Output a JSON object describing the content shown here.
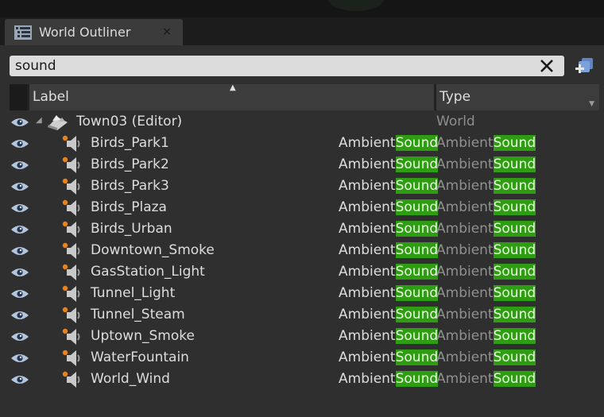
{
  "tab": {
    "title": "World Outliner",
    "close_glyph": "×"
  },
  "search": {
    "value": "sound"
  },
  "columns": {
    "label": "Label",
    "type": "Type"
  },
  "colors": {
    "highlight": "#2f9d12",
    "panel": "#2f2f2f",
    "search_bg": "#dcdcdc"
  },
  "root": {
    "label": "Town03 (Editor)",
    "type": "World",
    "icon": "world-icon"
  },
  "items": [
    {
      "label": "Birds_Park1",
      "class_prefix": "Ambient",
      "class_match": "Sound",
      "type_prefix": "Ambient",
      "type_match": "Sound"
    },
    {
      "label": "Birds_Park2",
      "class_prefix": "Ambient",
      "class_match": "Sound",
      "type_prefix": "Ambient",
      "type_match": "Sound"
    },
    {
      "label": "Birds_Park3",
      "class_prefix": "Ambient",
      "class_match": "Sound",
      "type_prefix": "Ambient",
      "type_match": "Sound"
    },
    {
      "label": "Birds_Plaza",
      "class_prefix": "Ambient",
      "class_match": "Sound",
      "type_prefix": "Ambient",
      "type_match": "Sound"
    },
    {
      "label": "Birds_Urban",
      "class_prefix": "Ambient",
      "class_match": "Sound",
      "type_prefix": "Ambient",
      "type_match": "Sound"
    },
    {
      "label": "Downtown_Smoke",
      "class_prefix": "Ambient",
      "class_match": "Sound",
      "type_prefix": "Ambient",
      "type_match": "Sound"
    },
    {
      "label": "GasStation_Light",
      "class_prefix": "Ambient",
      "class_match": "Sound",
      "type_prefix": "Ambient",
      "type_match": "Sound"
    },
    {
      "label": "Tunnel_Light",
      "class_prefix": "Ambient",
      "class_match": "Sound",
      "type_prefix": "Ambient",
      "type_match": "Sound"
    },
    {
      "label": "Tunnel_Steam",
      "class_prefix": "Ambient",
      "class_match": "Sound",
      "type_prefix": "Ambient",
      "type_match": "Sound"
    },
    {
      "label": "Uptown_Smoke",
      "class_prefix": "Ambient",
      "class_match": "Sound",
      "type_prefix": "Ambient",
      "type_match": "Sound"
    },
    {
      "label": "WaterFountain",
      "class_prefix": "Ambient",
      "class_match": "Sound",
      "type_prefix": "Ambient",
      "type_match": "Sound"
    },
    {
      "label": "World_Wind",
      "class_prefix": "Ambient",
      "class_match": "Sound",
      "type_prefix": "Ambient",
      "type_match": "Sound"
    }
  ]
}
